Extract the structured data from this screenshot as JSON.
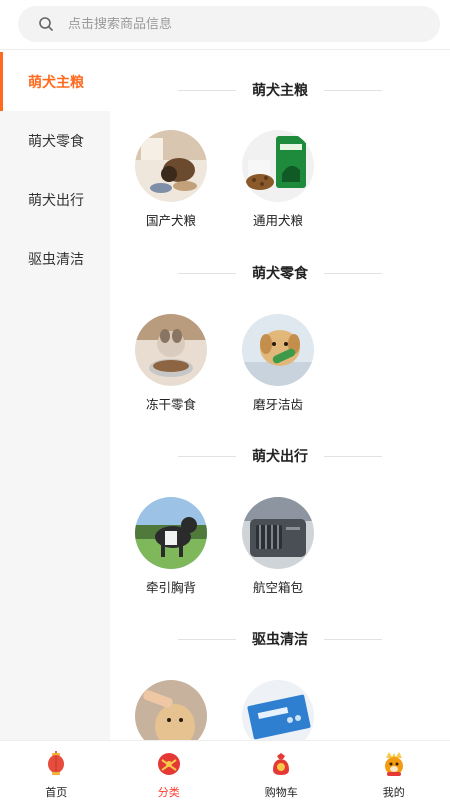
{
  "search": {
    "placeholder": "点击搜索商品信息"
  },
  "sidebar": {
    "items": [
      {
        "label": "萌犬主粮",
        "active": true
      },
      {
        "label": "萌犬零食",
        "active": false
      },
      {
        "label": "萌犬出行",
        "active": false
      },
      {
        "label": "驱虫清洁",
        "active": false
      }
    ]
  },
  "sections": [
    {
      "title": "萌犬主粮",
      "items": [
        {
          "label": "国产犬粮",
          "image": "dog-eating-photo"
        },
        {
          "label": "通用犬粮",
          "image": "dog-food-bag-photo"
        }
      ]
    },
    {
      "title": "萌犬零食",
      "items": [
        {
          "label": "冻干零食",
          "image": "dog-with-bowl-photo"
        },
        {
          "label": "磨牙洁齿",
          "image": "puppy-chew-toy-photo"
        }
      ]
    },
    {
      "title": "萌犬出行",
      "items": [
        {
          "label": "牵引胸背",
          "image": "dog-harness-photo"
        },
        {
          "label": "航空箱包",
          "image": "pet-carrier-photo"
        }
      ]
    },
    {
      "title": "驱虫清洁",
      "items": [
        {
          "label": "",
          "image": "dog-grooming-photo"
        },
        {
          "label": "",
          "image": "dewormer-box-photo"
        }
      ]
    }
  ],
  "tabbar": {
    "tabs": [
      {
        "label": "首页",
        "icon": "lantern-icon",
        "active": false
      },
      {
        "label": "分类",
        "icon": "gift-ball-icon",
        "active": true
      },
      {
        "label": "购物车",
        "icon": "money-bag-icon",
        "active": false
      },
      {
        "label": "我的",
        "icon": "tiger-mascot-icon",
        "active": false
      }
    ]
  },
  "colors": {
    "accent": "#ff6a1f",
    "tab_active": "#ff3a2b",
    "sidebar_bg": "#f6f6f6"
  }
}
